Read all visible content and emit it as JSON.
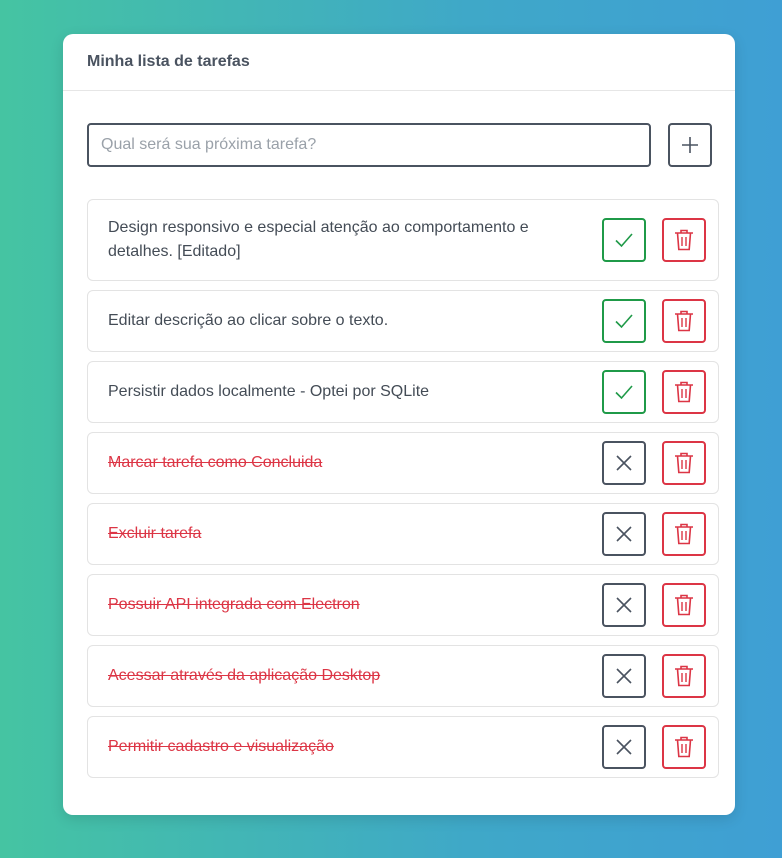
{
  "header": {
    "title": "Minha lista de tarefas"
  },
  "new_task": {
    "placeholder": "Qual será sua próxima tarefa?",
    "value": ""
  },
  "colors": {
    "accent_green": "#1f9a48",
    "accent_red": "#dc3545",
    "dark": "#4a5360"
  },
  "tasks": [
    {
      "text": "Design responsivo e especial atenção ao comportamento e detalhes. [Editado]",
      "done": false
    },
    {
      "text": "Editar descrição ao clicar sobre o texto.",
      "done": false
    },
    {
      "text": "Persistir dados localmente - Optei por SQLite",
      "done": false
    },
    {
      "text": "Marcar tarefa como Concluida",
      "done": true
    },
    {
      "text": "Excluir tarefa",
      "done": true
    },
    {
      "text": "Possuir API integrada com Electron",
      "done": true
    },
    {
      "text": "Acessar através da aplicação Desktop",
      "done": true
    },
    {
      "text": "Permitir cadastro e visualização",
      "done": true
    }
  ],
  "icons": {
    "add": "plus-icon",
    "complete": "check-icon",
    "reopen": "x-icon",
    "delete": "trash-icon"
  }
}
